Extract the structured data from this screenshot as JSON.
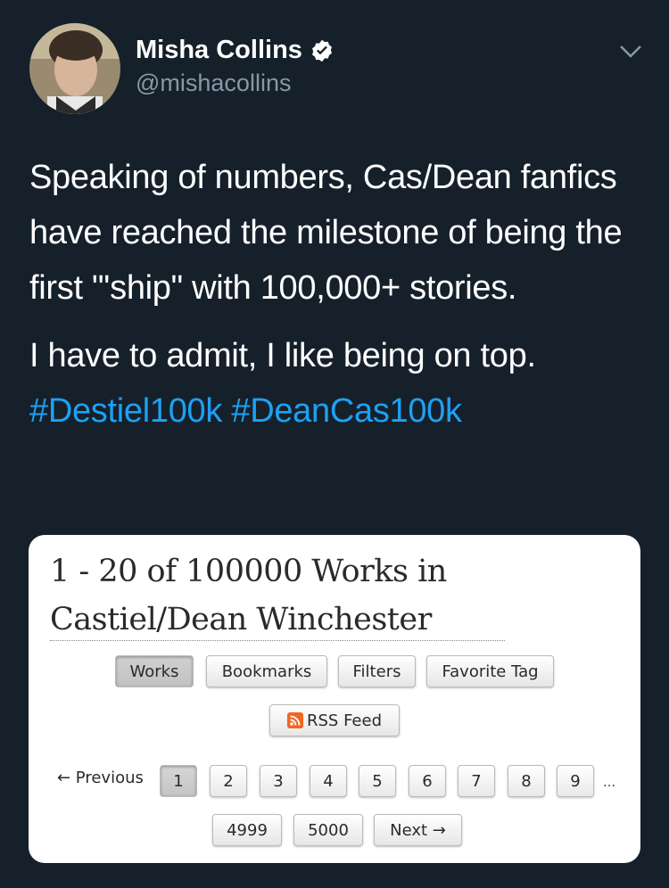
{
  "author": {
    "name": "Misha Collins",
    "handle": "@mishacollins"
  },
  "tweet": {
    "paragraph1": "Speaking of numbers, Cas/Dean fanfics have reached the milestone of being the first \"'ship\" with 100,000+ stories.",
    "paragraph2": "I have to admit, I like being on top.",
    "hashtags": [
      "#Destiel100k",
      "#DeanCas100k"
    ]
  },
  "card": {
    "title": "1 - 20 of 100000 Works in Castiel/Dean Winchester",
    "nav_buttons": [
      "Works",
      "Bookmarks",
      "Filters",
      "Favorite Tag"
    ],
    "rss_label": "RSS Feed",
    "previous_label": "← Previous",
    "pages": [
      "1",
      "2",
      "3",
      "4",
      "5",
      "6",
      "7",
      "8",
      "9"
    ],
    "ellipsis": "…",
    "last_pages": [
      "4999",
      "5000"
    ],
    "next_label": "Next →"
  },
  "colors": {
    "background": "#15202b",
    "hashtag": "#1da1f2",
    "verified": "#ffffff",
    "rss": "#f26522"
  }
}
